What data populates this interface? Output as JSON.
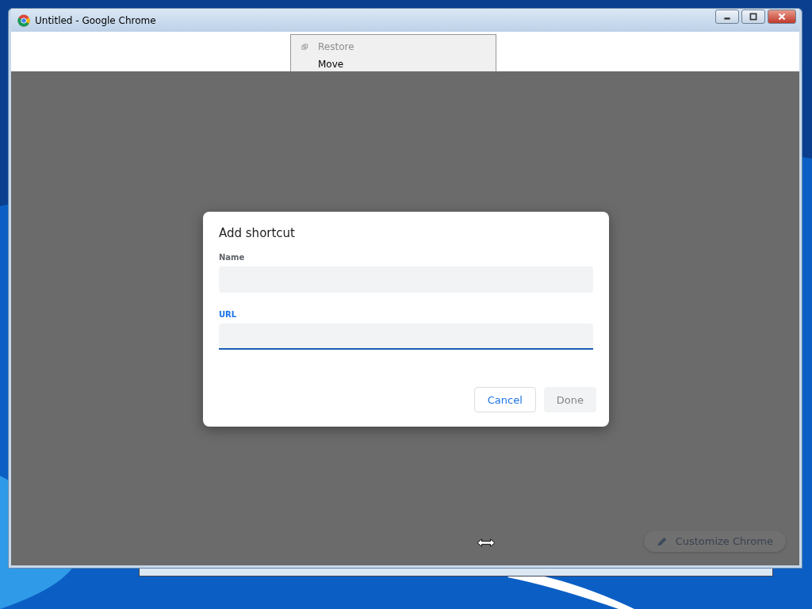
{
  "window": {
    "title": "Untitled - Google Chrome"
  },
  "system_menu": {
    "items": [
      {
        "label": "Restore",
        "disabled": true
      },
      {
        "label": "Move",
        "disabled": false
      }
    ]
  },
  "dialog": {
    "title": "Add shortcut",
    "fields": [
      {
        "label": "Name",
        "focused": false
      },
      {
        "label": "URL",
        "focused": true
      }
    ],
    "buttons": [
      {
        "label": "Cancel",
        "kind": "secondary",
        "disabled": false
      },
      {
        "label": "Done",
        "kind": "primary",
        "disabled": true
      }
    ]
  },
  "customize_button": {
    "label": "Customize Chrome"
  }
}
